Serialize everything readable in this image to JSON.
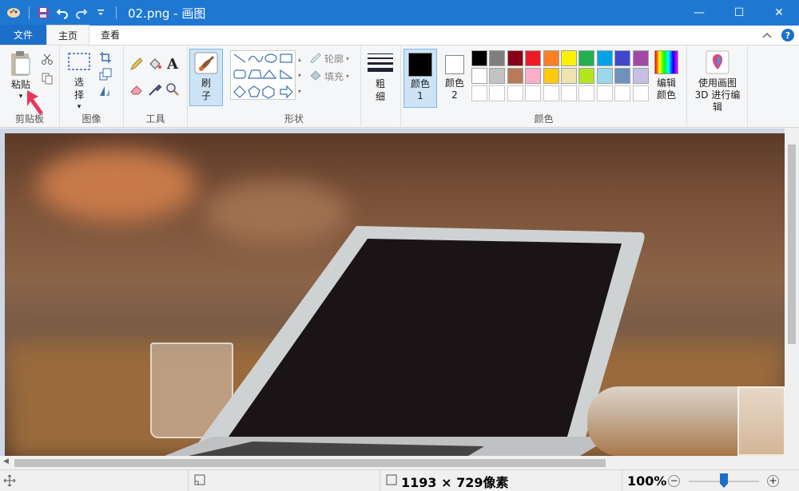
{
  "window": {
    "title": "02.png - 画图",
    "controls": {
      "minimize": "—",
      "maximize": "☐",
      "close": "✕"
    }
  },
  "tabs": [
    {
      "label": "文件",
      "active": false
    },
    {
      "label": "主页",
      "active": true
    },
    {
      "label": "查看",
      "active": false
    }
  ],
  "help": "?",
  "ribbon": {
    "clipboard": {
      "label": "剪贴板",
      "paste_label": "粘贴"
    },
    "image": {
      "label": "图像",
      "select_label": "选择"
    },
    "tools": {
      "label": "工具"
    },
    "brush": {
      "label": "刷子"
    },
    "shapes": {
      "label": "形状",
      "outline_label": "轮廓",
      "fill_label": "填充"
    },
    "size": {
      "label": "粗细"
    },
    "colors": {
      "label": "颜色",
      "color1_label": "颜色 1",
      "color2_label": "颜色 2",
      "color1": "#000000",
      "color2": "#ffffff",
      "edit_label": "编辑颜色",
      "palette_row1": [
        "#000000",
        "#7f7f7f",
        "#880015",
        "#ed1c24",
        "#ff7f27",
        "#fff200",
        "#22b14c",
        "#00a2e8",
        "#3f48cc",
        "#a349a4"
      ],
      "palette_row2": [
        "#ffffff",
        "#c3c3c3",
        "#b97a57",
        "#ffaec9",
        "#ffc90e",
        "#efe4b0",
        "#b5e61d",
        "#99d9ea",
        "#7092be",
        "#c8bfe7"
      ]
    },
    "paint3d": {
      "label": "使用画图 3D 进行编辑"
    }
  },
  "status": {
    "dimensions": "1193 × 729像素",
    "zoom": "100%",
    "zoom_level": 0.5
  }
}
